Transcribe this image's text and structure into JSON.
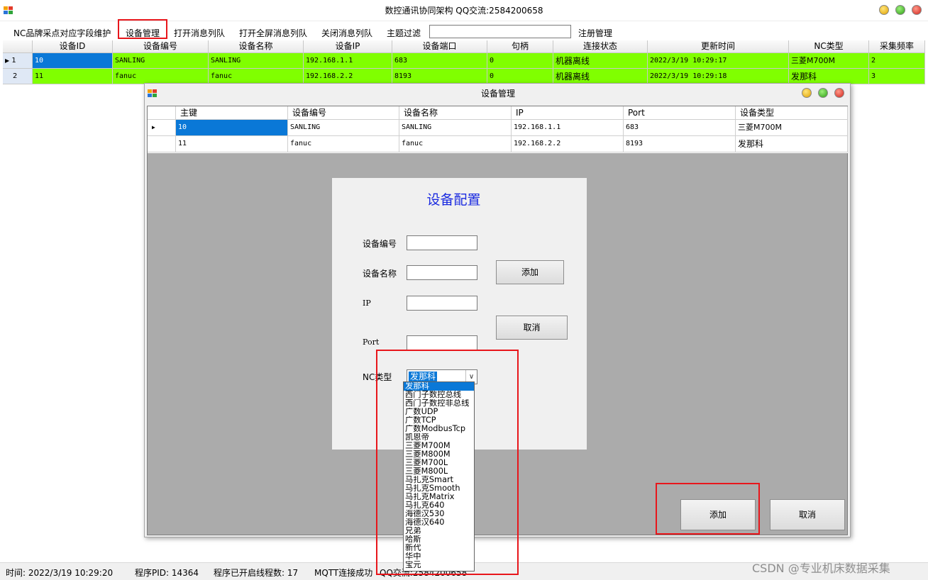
{
  "window": {
    "title": "数控通讯协同架构 QQ交流:2584200658"
  },
  "menu": {
    "items": [
      "NC品牌采点对应字段维护",
      "设备管理",
      "打开消息列队",
      "打开全屏消息列队",
      "关闭消息列队",
      "主题过滤"
    ],
    "filter_value": "",
    "register": "注册管理"
  },
  "main_grid": {
    "columns": [
      "设备ID",
      "设备编号",
      "设备名称",
      "设备IP",
      "设备端口",
      "句柄",
      "连接状态",
      "更新时间",
      "NC类型",
      "采集频率"
    ],
    "rows": [
      {
        "index": "1",
        "id": "10",
        "code": "SANLING",
        "name": "SANLING",
        "ip": "192.168.1.1",
        "port": "683",
        "handle": "0",
        "status": "机器离线",
        "time": "2022/3/19 10:29:17",
        "nc": "三菱M700M",
        "freq": "2"
      },
      {
        "index": "2",
        "id": "11",
        "code": "fanuc",
        "name": "fanuc",
        "ip": "192.168.2.2",
        "port": "8193",
        "handle": "0",
        "status": "机器离线",
        "time": "2022/3/19 10:29:18",
        "nc": "发那科",
        "freq": "3"
      }
    ]
  },
  "dialog": {
    "title": "设备管理",
    "grid": {
      "columns": [
        "主键",
        "设备编号",
        "设备名称",
        "IP",
        "Port",
        "设备类型"
      ],
      "rows": [
        {
          "key": "10",
          "code": "SANLING",
          "name": "SANLING",
          "ip": "192.168.1.1",
          "port": "683",
          "type": "三菱M700M"
        },
        {
          "key": "11",
          "code": "fanuc",
          "name": "fanuc",
          "ip": "192.168.2.2",
          "port": "8193",
          "type": "发那科"
        }
      ]
    },
    "config": {
      "heading": "设备配置",
      "labels": {
        "code": "设备编号",
        "name": "设备名称",
        "ip": "IP",
        "port": "Port",
        "nc": "NC类型"
      },
      "values": {
        "code": "",
        "name": "",
        "ip": "",
        "port": ""
      },
      "add": "添加",
      "cancel": "取消",
      "nc_selected": "发那科",
      "nc_options": [
        "发那科",
        "西门子数控总线",
        "西门子数控非总线",
        "广数UDP",
        "广数TCP",
        "广数ModbusTcp",
        "凯恩帝",
        "三菱M700M",
        "三菱M800M",
        "三菱M700L",
        "三菱M800L",
        "马扎克Smart",
        "马扎克Smooth",
        "马扎克Matrix",
        "马扎克640",
        "海德汉530",
        "海德汉640",
        "兄弟",
        "哈斯",
        "新代",
        "华中",
        "宝元"
      ]
    },
    "bottom_add": "添加",
    "bottom_cancel": "取消"
  },
  "status": {
    "time": "时间:  2022/3/19 10:29:20",
    "pid": "程序PID:  14364",
    "threads": "程序已开启线程数:  17",
    "mqtt": "MQTT连接成功",
    "qq": "QQ交流:2584200658"
  },
  "watermark": "CSDN @专业机床数据采集",
  "colors": {
    "row_green": "#80ff00",
    "selection": "#0a78d7",
    "highlight_red": "#e8161b",
    "heading_blue": "#1a2ae0"
  }
}
